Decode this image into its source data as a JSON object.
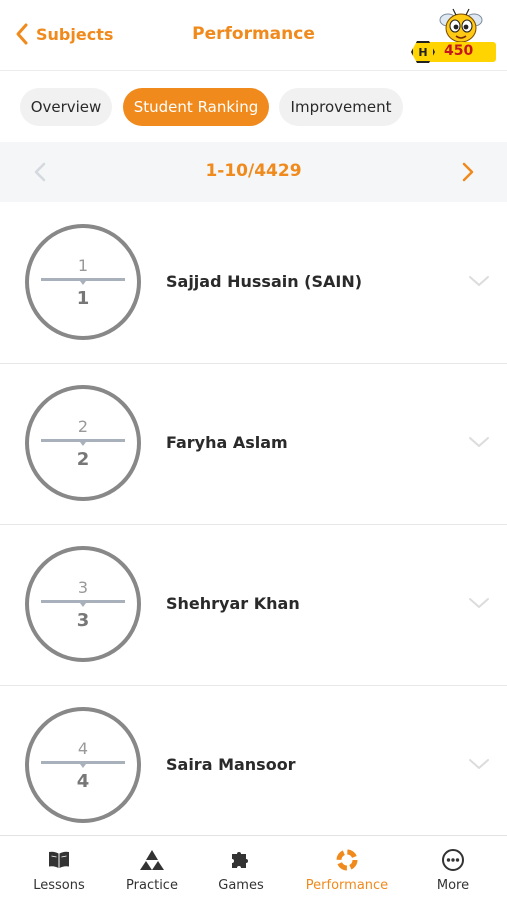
{
  "header": {
    "back_label": "Subjects",
    "title": "Performance",
    "coin_badge_letter": "H",
    "coin_count": "450"
  },
  "tabs": [
    {
      "label": "Overview",
      "active": false
    },
    {
      "label": "Student Ranking",
      "active": true
    },
    {
      "label": "Improvement",
      "active": false
    }
  ],
  "pager": {
    "range": "1-10/4429"
  },
  "ranking": [
    {
      "rank_top": "1",
      "rank_bottom": "1",
      "name": "Sajjad Hussain (SAIN)"
    },
    {
      "rank_top": "2",
      "rank_bottom": "2",
      "name": "Faryha Aslam"
    },
    {
      "rank_top": "3",
      "rank_bottom": "3",
      "name": "Shehryar Khan"
    },
    {
      "rank_top": "4",
      "rank_bottom": "4",
      "name": "Saira Mansoor"
    }
  ],
  "bottom_nav": [
    {
      "label": "Lessons",
      "icon": "book-icon"
    },
    {
      "label": "Practice",
      "icon": "triangle-stack-icon"
    },
    {
      "label": "Games",
      "icon": "puzzle-icon"
    },
    {
      "label": "Performance",
      "icon": "performance-ring-icon",
      "active": true
    },
    {
      "label": "More",
      "icon": "more-dots-icon"
    }
  ],
  "colors": {
    "accent": "#f08a1c",
    "coin": "#ffd400",
    "coin_text": "#c5161d"
  }
}
